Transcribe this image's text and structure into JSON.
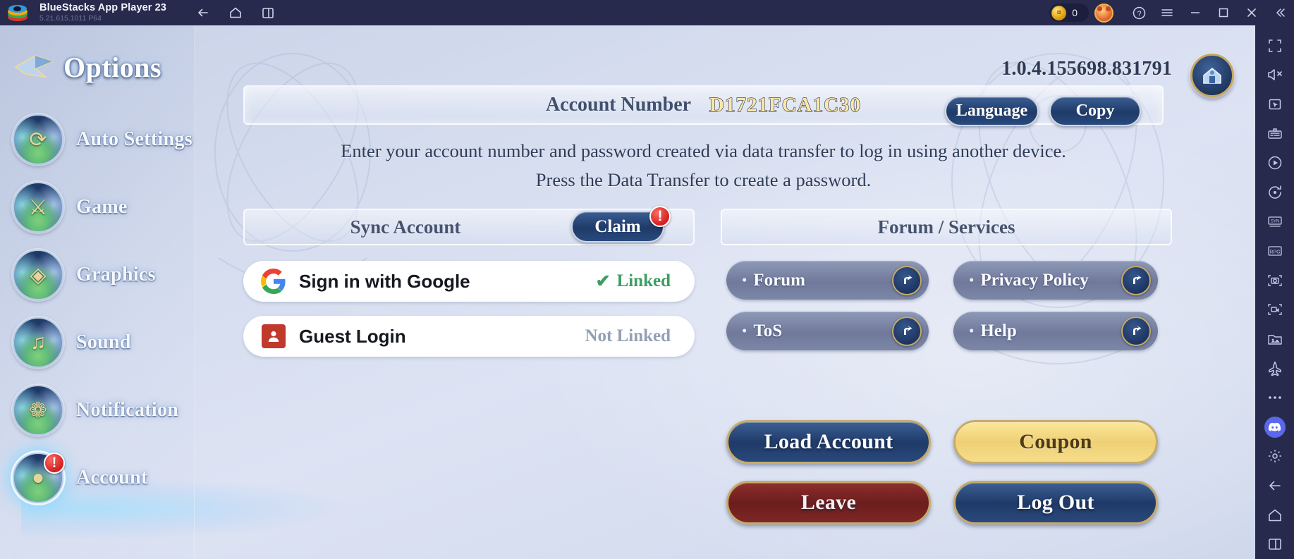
{
  "bluestacks": {
    "app_title": "BlueStacks App Player 23",
    "app_version": "5.21.615.1011  P64",
    "logo_icon": "bluestacks-logo-icon",
    "nav": [
      {
        "name": "back-icon",
        "label": "Back"
      },
      {
        "name": "home-icon",
        "label": "Home"
      },
      {
        "name": "multi-instance-icon",
        "label": "Multi-instance"
      }
    ],
    "coin": {
      "icon": "coin-icon",
      "value": "0"
    },
    "avatar_icon": "user-avatar-icon",
    "window_controls": [
      {
        "name": "help-icon",
        "glyph": "?"
      },
      {
        "name": "menu-icon",
        "glyph": "☰"
      },
      {
        "name": "minimize-icon",
        "glyph": "–"
      },
      {
        "name": "maximize-icon",
        "glyph": "□"
      },
      {
        "name": "close-icon",
        "glyph": "✕"
      },
      {
        "name": "collapse-sidebar-icon",
        "glyph": "«"
      }
    ],
    "sidebar_icons": [
      "fullscreen-icon",
      "mute-icon",
      "cursor-pointer-icon",
      "keyboard-controls-icon",
      "macro-record-icon",
      "rotate-icon",
      "multi-instance-sync-icon",
      "rpg-mode-icon",
      "screenshot-icon",
      "screen-record-icon",
      "media-manager-icon",
      "airplane-mode-icon",
      "more-options-icon",
      "discord-icon",
      "settings-gear-icon",
      "back-arrow-icon",
      "home-icon",
      "recent-apps-icon"
    ]
  },
  "game": {
    "version": "1.0.4.155698.831791",
    "home_button_icon": "home-shield-icon",
    "options_title": "Options",
    "options_title_icon": "options-arrow-icon",
    "nav_items": [
      {
        "label": "Auto Settings",
        "icon": "auto-settings-icon",
        "glyph": "⟳",
        "alert": false,
        "active": false
      },
      {
        "label": "Game",
        "icon": "game-swords-icon",
        "glyph": "⚔",
        "alert": false,
        "active": false
      },
      {
        "label": "Graphics",
        "icon": "graphics-icon",
        "glyph": "◈",
        "alert": false,
        "active": false
      },
      {
        "label": "Sound",
        "icon": "sound-note-icon",
        "glyph": "♫",
        "alert": false,
        "active": false
      },
      {
        "label": "Notification",
        "icon": "notification-bell-icon",
        "glyph": "❁",
        "alert": false,
        "active": false
      },
      {
        "label": "Account",
        "icon": "account-person-icon",
        "glyph": "●",
        "alert": true,
        "active": true,
        "alert_glyph": "!"
      }
    ],
    "account_bar": {
      "label": "Account Number",
      "value": "D1721FCA1C30",
      "language_button": "Language",
      "copy_button": "Copy"
    },
    "description_line_1": "Enter your account number and password created via data transfer to log in using another device.",
    "description_line_2": "Press the Data Transfer to create a password.",
    "sync_section": {
      "title": "Sync Account",
      "claim_button": "Claim",
      "claim_alert_glyph": "!",
      "rows": [
        {
          "name": "Sign in with Google",
          "icon": "google-g-icon",
          "status": "Linked",
          "status_state": "linked",
          "check_glyph": "✔"
        },
        {
          "name": "Guest Login",
          "icon": "guest-person-icon",
          "status": "Not Linked",
          "status_state": "notlinked",
          "check_glyph": ""
        }
      ]
    },
    "forum_section": {
      "title": "Forum / Services",
      "links": [
        {
          "label": "Forum",
          "icon": "external-link-icon"
        },
        {
          "label": "ToS",
          "icon": "external-link-icon"
        },
        {
          "label": "Privacy Policy",
          "icon": "external-link-icon"
        },
        {
          "label": "Help",
          "icon": "external-link-icon"
        }
      ]
    },
    "actions": [
      {
        "label": "Load Account",
        "style": "blue"
      },
      {
        "label": "Leave",
        "style": "red"
      },
      {
        "label": "Coupon",
        "style": "gold"
      },
      {
        "label": "Log Out",
        "style": "blue"
      }
    ],
    "colors": {
      "accent_blue": "#1f3a68",
      "accent_gold": "#efd075",
      "accent_red": "#6c1d1d",
      "linked_green": "#3e9e62",
      "notlinked_grey": "#93a0b5",
      "account_value": "#fbe7a8",
      "alert_red": "#d41f22"
    }
  }
}
